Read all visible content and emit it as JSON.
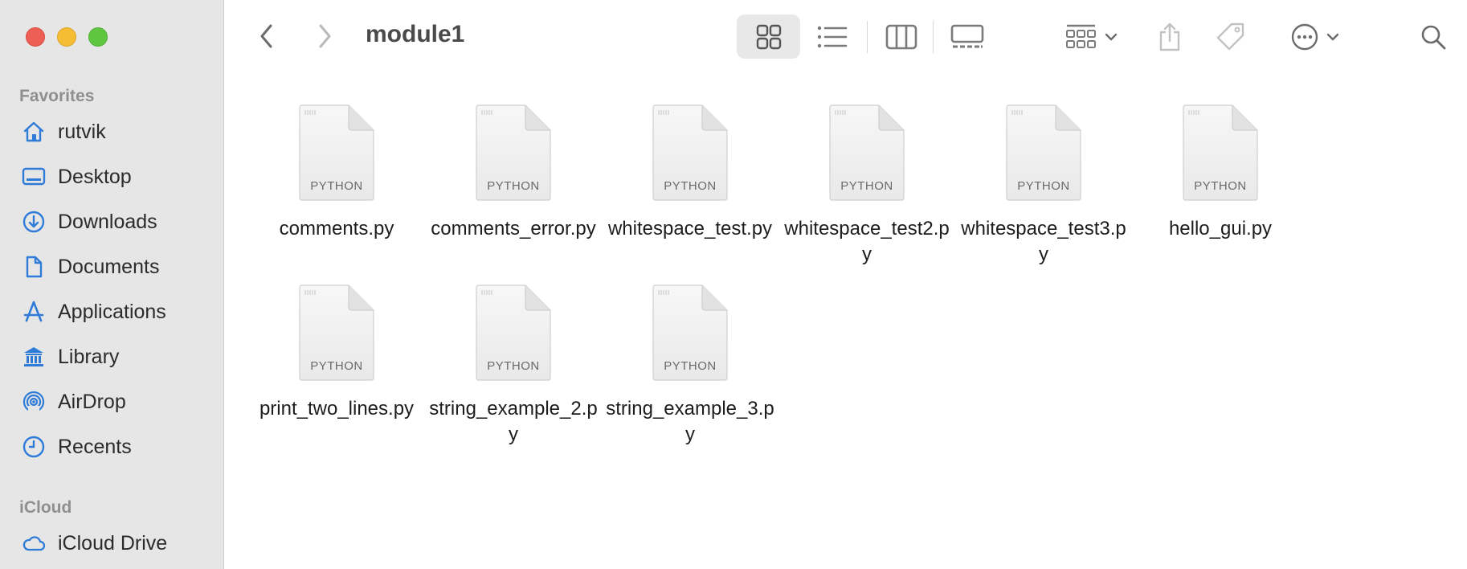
{
  "window": {
    "title": "module1",
    "traffic_lights": [
      "close",
      "minimize",
      "zoom"
    ]
  },
  "sidebar": {
    "sections": [
      {
        "title": "Favorites",
        "items": [
          {
            "label": "rutvik",
            "icon": "home-icon"
          },
          {
            "label": "Desktop",
            "icon": "desktop-icon"
          },
          {
            "label": "Downloads",
            "icon": "downloads-icon"
          },
          {
            "label": "Documents",
            "icon": "document-icon"
          },
          {
            "label": "Applications",
            "icon": "applications-icon"
          },
          {
            "label": "Library",
            "icon": "library-icon"
          },
          {
            "label": "AirDrop",
            "icon": "airdrop-icon"
          },
          {
            "label": "Recents",
            "icon": "clock-icon"
          }
        ]
      },
      {
        "title": "iCloud",
        "items": [
          {
            "label": "iCloud Drive",
            "icon": "cloud-icon"
          }
        ]
      }
    ]
  },
  "toolbar": {
    "buttons": [
      "back",
      "forward",
      "icon-view",
      "list-view",
      "column-view",
      "gallery-view",
      "group",
      "share",
      "tag",
      "more",
      "search"
    ],
    "active_view": "icon-view"
  },
  "files": [
    {
      "name": "comments.py",
      "type": "PYTHON"
    },
    {
      "name": "comments_error.py",
      "type": "PYTHON"
    },
    {
      "name": "whitespace_test.py",
      "type": "PYTHON"
    },
    {
      "name": "whitespace_test2.py",
      "type": "PYTHON"
    },
    {
      "name": "whitespace_test3.py",
      "type": "PYTHON"
    },
    {
      "name": "hello_gui.py",
      "type": "PYTHON"
    },
    {
      "name": "print_two_lines.py",
      "type": "PYTHON"
    },
    {
      "name": "string_example_2.py",
      "type": "PYTHON"
    },
    {
      "name": "string_example_3.py",
      "type": "PYTHON"
    }
  ],
  "colors": {
    "sidebar_bg": "#e6e6e6",
    "sidebar_icon": "#2f7bd8",
    "section_title": "#8f8f8f",
    "toolbar_icon": "#7a7a7a"
  }
}
